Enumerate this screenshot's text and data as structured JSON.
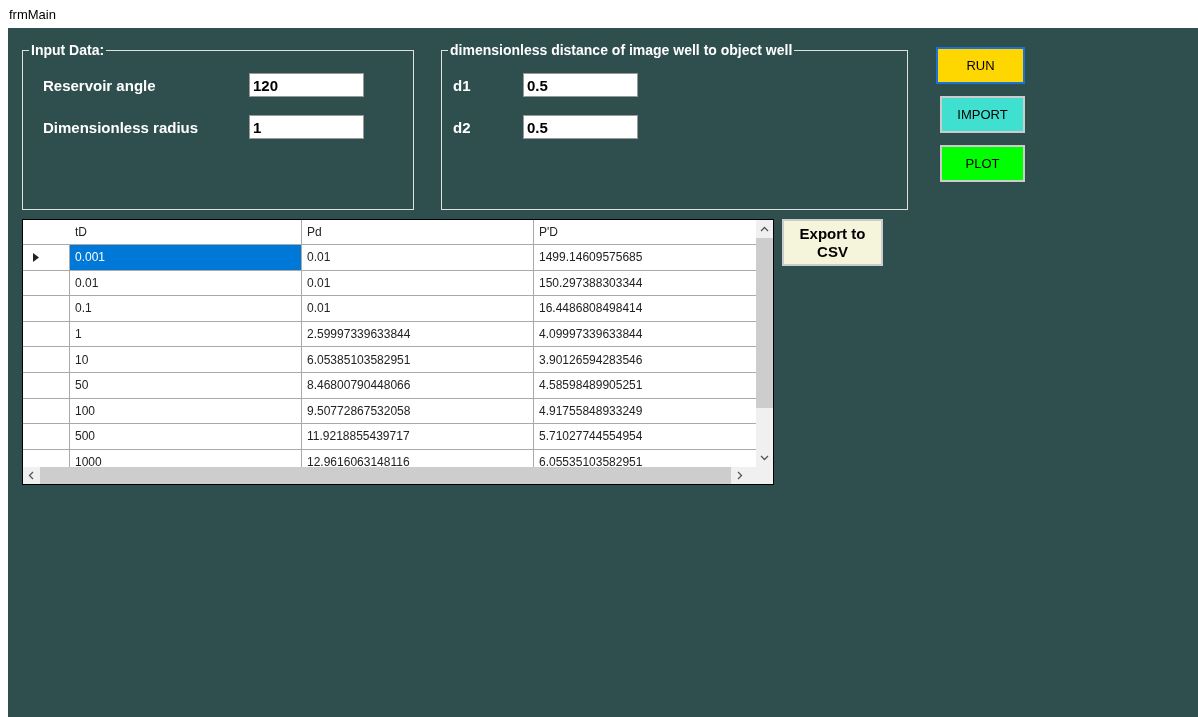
{
  "window": {
    "title": "frmMain"
  },
  "input_group": {
    "title": "Input Data:",
    "fields": [
      {
        "label": "Reservoir angle",
        "value": "120"
      },
      {
        "label": "Dimensionless radius",
        "value": "1"
      }
    ]
  },
  "distance_group": {
    "title": "dimensionless distance of  image well to object well",
    "fields": [
      {
        "label": "d1",
        "value": "0.5"
      },
      {
        "label": "d2",
        "value": "0.5"
      }
    ]
  },
  "buttons": [
    {
      "label": "RUN",
      "color": "#ffd700",
      "focused": true
    },
    {
      "label": "IMPORT",
      "color": "#40e0d0",
      "focused": false
    },
    {
      "label": "PLOT",
      "color": "#00ff00",
      "focused": false
    }
  ],
  "table": {
    "columns": [
      "tD",
      "Pd",
      "P'D"
    ],
    "rows": [
      {
        "selected": true,
        "cells": [
          "0.001",
          "0.01",
          "1499.14609575685"
        ]
      },
      {
        "selected": false,
        "cells": [
          "0.01",
          "0.01",
          "150.297388303344"
        ]
      },
      {
        "selected": false,
        "cells": [
          "0.1",
          "0.01",
          "16.4486808498414"
        ]
      },
      {
        "selected": false,
        "cells": [
          "1",
          "2.59997339633844",
          "4.09997339633844"
        ]
      },
      {
        "selected": false,
        "cells": [
          "10",
          "6.05385103582951",
          "3.90126594283546"
        ]
      },
      {
        "selected": false,
        "cells": [
          "50",
          "8.46800790448066",
          "4.58598489905251"
        ]
      },
      {
        "selected": false,
        "cells": [
          "100",
          "9.50772867532058",
          "4.91755848933249"
        ]
      },
      {
        "selected": false,
        "cells": [
          "500",
          "11.9218855439717",
          "5.71027744554954"
        ]
      },
      {
        "selected": false,
        "cells": [
          "1000",
          "12.9616063148116",
          "6.05535103582951"
        ]
      }
    ]
  },
  "export_button": {
    "label": "Export to CSV"
  }
}
